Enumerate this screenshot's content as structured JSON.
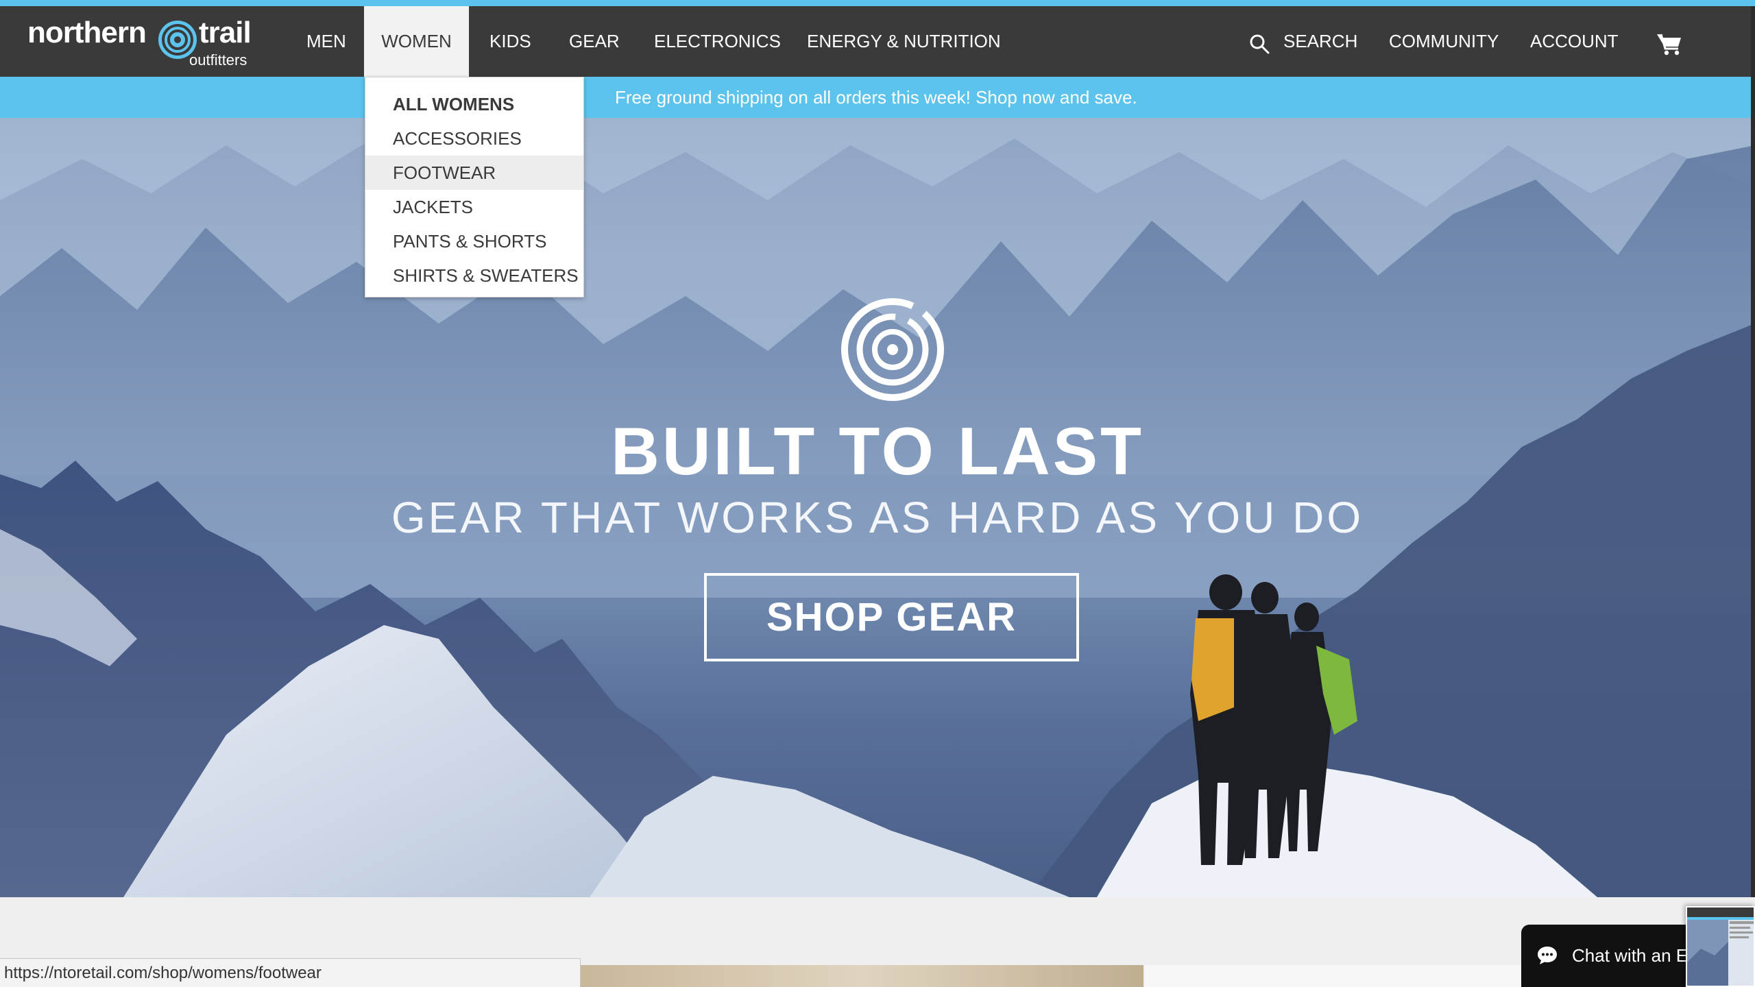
{
  "brand": {
    "logo_top": "northern",
    "logo_top_right": "trail",
    "logo_bottom": "outfitters"
  },
  "nav": {
    "items": [
      {
        "label": "MEN"
      },
      {
        "label": "WOMEN",
        "active": true
      },
      {
        "label": "KIDS"
      },
      {
        "label": "GEAR"
      },
      {
        "label": "ELECTRONICS"
      },
      {
        "label": "ENERGY & NUTRITION"
      }
    ],
    "search_label": "SEARCH",
    "community_label": "COMMUNITY",
    "account_label": "ACCOUNT",
    "cart_icon": "cart-icon",
    "search_icon": "search-icon"
  },
  "dropdown": {
    "items": [
      {
        "label": "ALL WOMENS",
        "bold": true
      },
      {
        "label": "ACCESSORIES"
      },
      {
        "label": "FOOTWEAR",
        "hovered": true
      },
      {
        "label": "JACKETS"
      },
      {
        "label": "PANTS & SHORTS"
      },
      {
        "label": "SHIRTS & SWEATERS"
      }
    ]
  },
  "promo": {
    "text": "Free ground shipping on all orders this week! Shop now and save."
  },
  "hero": {
    "title": "BUILT TO LAST",
    "subtitle": "GEAR THAT WORKS AS HARD AS YOU DO",
    "cta": "SHOP GEAR"
  },
  "status_bar": {
    "url": "https://ntoretail.com/shop/womens/footwear"
  },
  "chat": {
    "label": "Chat with an Ex"
  },
  "colors": {
    "header": "#3a3a3a",
    "accent": "#5cc3ec",
    "dropdown_hover": "#ededed"
  }
}
